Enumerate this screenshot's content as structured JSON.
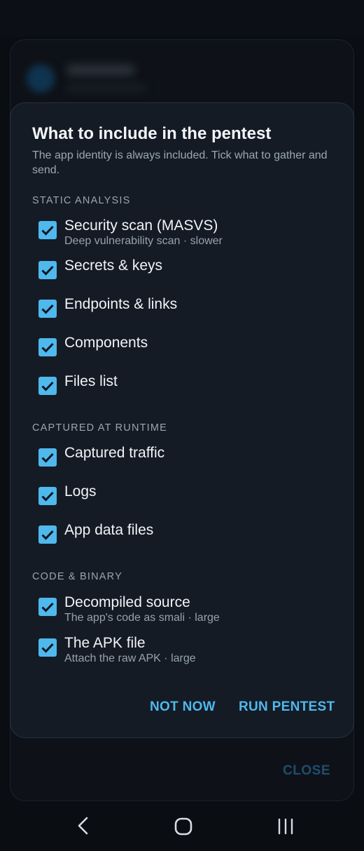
{
  "dialog": {
    "title": "What to include in the pentest",
    "subtitle": "The app identity is always included. Tick what to gather and send.",
    "sections": [
      {
        "heading": "STATIC ANALYSIS",
        "options": [
          {
            "label": "Security scan (MASVS)",
            "description": "Deep vulnerability scan · slower",
            "checked": true
          },
          {
            "label": "Secrets & keys",
            "checked": true
          },
          {
            "label": "Endpoints & links",
            "checked": true
          },
          {
            "label": "Components",
            "checked": true
          },
          {
            "label": "Files list",
            "checked": true
          }
        ]
      },
      {
        "heading": "CAPTURED AT RUNTIME",
        "options": [
          {
            "label": "Captured traffic",
            "checked": true
          },
          {
            "label": "Logs",
            "checked": true
          },
          {
            "label": "App data files",
            "checked": true
          }
        ]
      },
      {
        "heading": "CODE & BINARY",
        "options": [
          {
            "label": "Decompiled source",
            "description": "The app's code as smali · large",
            "checked": true
          },
          {
            "label": "The APK file",
            "description": "Attach the raw APK · large",
            "checked": true
          }
        ]
      }
    ],
    "buttons": {
      "not_now": "NOT NOW",
      "run_pentest": "RUN PENTEST"
    }
  },
  "background": {
    "close_label": "CLOSE"
  },
  "navbar": {
    "back_icon": "back-icon",
    "home_icon": "home-icon",
    "recents_icon": "recents-icon"
  },
  "colors": {
    "accent": "#4fb8ec",
    "dialog_bg": "#141b25",
    "page_bg": "#0a0d12"
  }
}
